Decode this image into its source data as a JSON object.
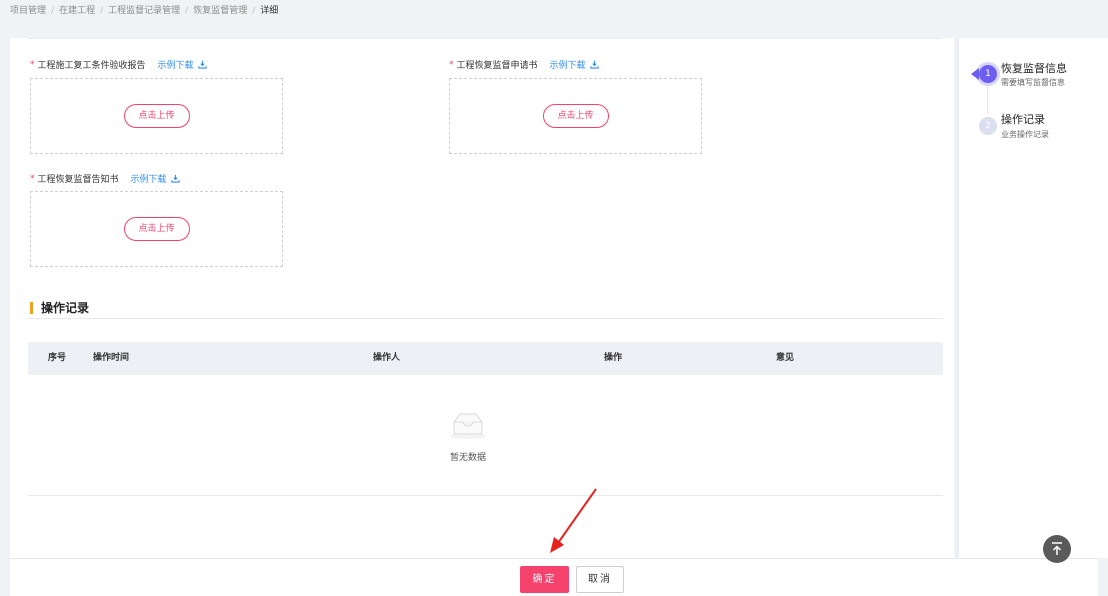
{
  "breadcrumb": {
    "items": [
      "项目管理",
      "在建工程",
      "工程监督记录管理",
      "恢复监督管理"
    ],
    "current": "详细",
    "separator": "/"
  },
  "uploads": [
    {
      "label": "工程施工复工条件验收报告",
      "download": "示例下载",
      "button": "点击上传"
    },
    {
      "label": "工程恢复监督申请书",
      "download": "示例下载",
      "button": "点击上传"
    },
    {
      "label": "工程恢复监督告知书",
      "download": "示例下载",
      "button": "点击上传"
    }
  ],
  "required_mark": "*",
  "records": {
    "title": "操作记录",
    "columns": [
      "序号",
      "操作时间",
      "操作人",
      "操作",
      "意见"
    ],
    "empty_text": "暂无数据"
  },
  "steps": [
    {
      "number": "1",
      "title": "恢复监督信息",
      "desc": "需要填写监督信息",
      "active": true
    },
    {
      "number": "2",
      "title": "操作记录",
      "desc": "业务操作记录",
      "active": false
    }
  ],
  "footer": {
    "confirm": "确定",
    "cancel": "取消"
  },
  "colors": {
    "primary": "#f5426c",
    "link": "#2d8cf0",
    "step_active": "#6e5ef0",
    "section_bar": "#f0a020",
    "annotation": "#e8231f"
  },
  "icons": [
    "download-icon",
    "empty-inbox-icon",
    "back-to-top-icon",
    "annotation-arrow"
  ]
}
